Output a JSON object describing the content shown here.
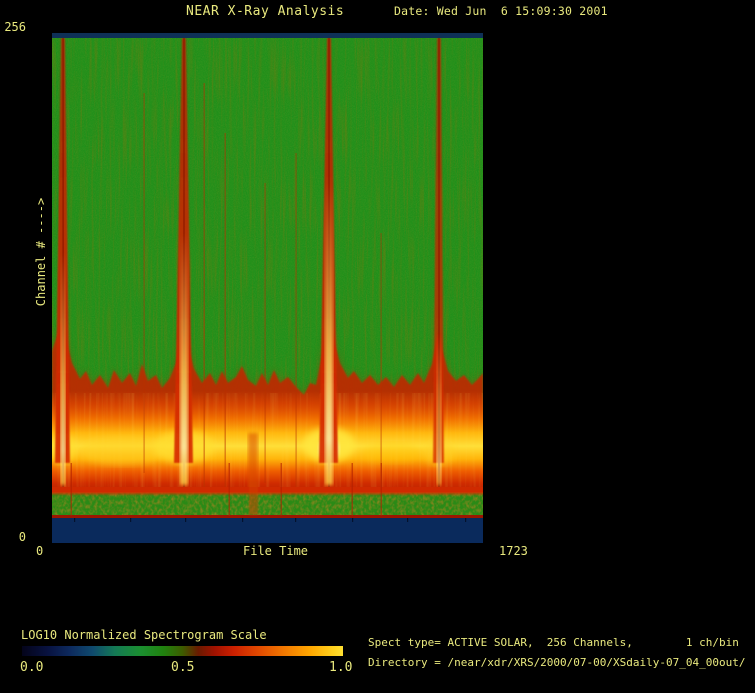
{
  "header": {
    "title": "NEAR X-Ray Analysis",
    "date": "Date: Wed Jun  6 15:09:30 2001"
  },
  "plot": {
    "y_axis": {
      "label": "Channel # ---->",
      "max_tick": "256",
      "min_tick": "0"
    },
    "x_axis": {
      "label": "File Time",
      "min_tick": "0",
      "max_tick": "1723"
    }
  },
  "legend": {
    "title": "LOG10 Normalized Spectrogram Scale",
    "ticks": [
      "0.0",
      "0.5",
      "1.0"
    ]
  },
  "info": {
    "spect_line": "Spect type= ACTIVE SOLAR,  256 Channels,        1 ch/bin",
    "directory_line": "Directory = /near/xdr/XRS/2000/07-00/XSdaily-07_04_00out/"
  },
  "colors": {
    "background": "#000000",
    "text_yellow": "#e9e97e",
    "plot_green": "#1f8f1a",
    "flare_red": "#c82500",
    "band_yellow": "#ffdf38",
    "frame_navy": "#0c2d5c"
  },
  "chart_data": {
    "type": "heatmap",
    "title": "NEAR X-Ray Analysis",
    "xlabel": "File Time",
    "ylabel": "Channel #",
    "xlim": [
      0,
      1723
    ],
    "ylim": [
      0,
      256
    ],
    "colorbar": {
      "label": "LOG10 Normalized Spectrogram Scale",
      "ticks": [
        0.0,
        0.5,
        1.0
      ],
      "gradient": [
        "#04041a",
        "#0d2a5e",
        "#147a55",
        "#1b8f30",
        "#20820f",
        "#6b1a00",
        "#cc2000",
        "#f27a00",
        "#ffa800",
        "#ffe033"
      ]
    },
    "background_value": 0.45,
    "bright_band": {
      "channels": [
        40,
        56
      ],
      "value": 1.0
    },
    "red_band": {
      "channels": [
        25,
        105
      ],
      "value": 0.65
    },
    "no_data_channels": [
      0,
      13
    ],
    "flare_events_file_time": [
      40,
      528,
      1107,
      1547
    ],
    "description": "256-channel X-ray spectrogram vs file time (0-1723). Uniform green mid-level background; four flare events form full-height red columns widening toward low channels; persistent bright yellow emission band near channels 40-56 over a red band (channels ~25-105); mottled green strip below; navy no-data margins at top and bottom."
  }
}
